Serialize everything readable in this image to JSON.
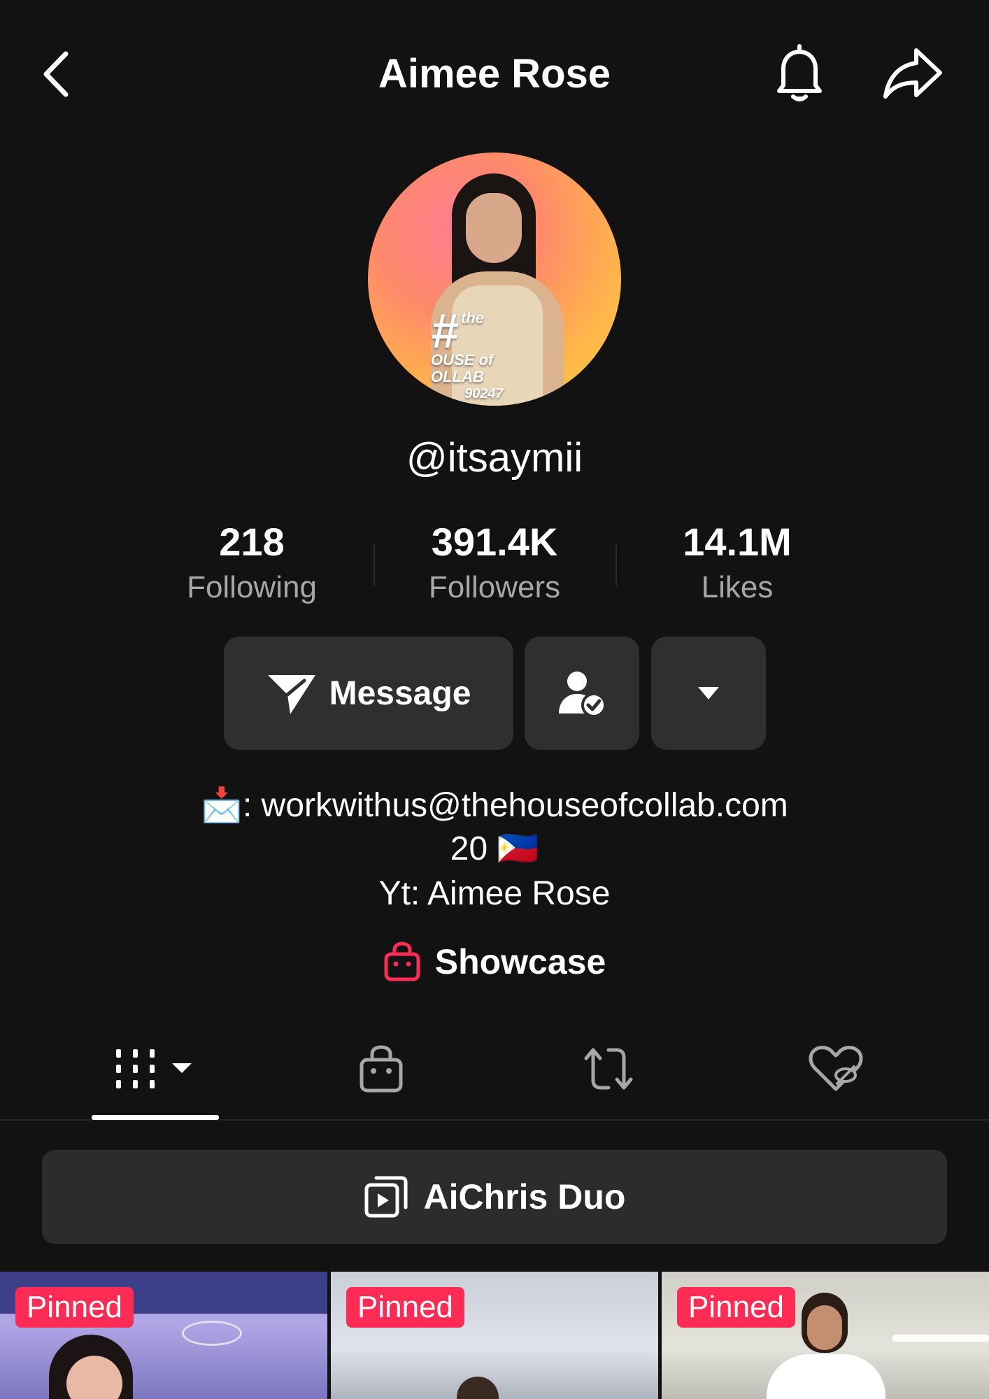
{
  "header": {
    "title": "Aimee Rose"
  },
  "profile": {
    "avatar_text": {
      "line1": "the",
      "line2": "OUSE of",
      "line3": "OLLAB",
      "number": "90247"
    },
    "username": "@itsaymii"
  },
  "stats": [
    {
      "value": "218",
      "label": "Following"
    },
    {
      "value": "391.4K",
      "label": "Followers"
    },
    {
      "value": "14.1M",
      "label": "Likes"
    }
  ],
  "actions": {
    "message_label": "Message"
  },
  "bio": {
    "line1": "📩: workwithus@thehouseofcollab.com",
    "line2": "20 🇵🇭",
    "line3": "Yt: Aimee Rose"
  },
  "showcase": {
    "label": "Showcase",
    "icon_color": "#fe2c55"
  },
  "tabs": [
    {
      "icon": "videos-grid-icon"
    },
    {
      "icon": "shop-bag-icon"
    },
    {
      "icon": "repost-icon"
    },
    {
      "icon": "liked-hidden-icon"
    }
  ],
  "playlist": {
    "label": "AiChris Duo"
  },
  "videos": [
    {
      "badge": "Pinned"
    },
    {
      "badge": "Pinned"
    },
    {
      "badge": "Pinned"
    }
  ],
  "colors": {
    "background": "#121212",
    "button": "#2f2f2f",
    "accent": "#fe2c55",
    "muted_text": "#a7a7a7"
  }
}
